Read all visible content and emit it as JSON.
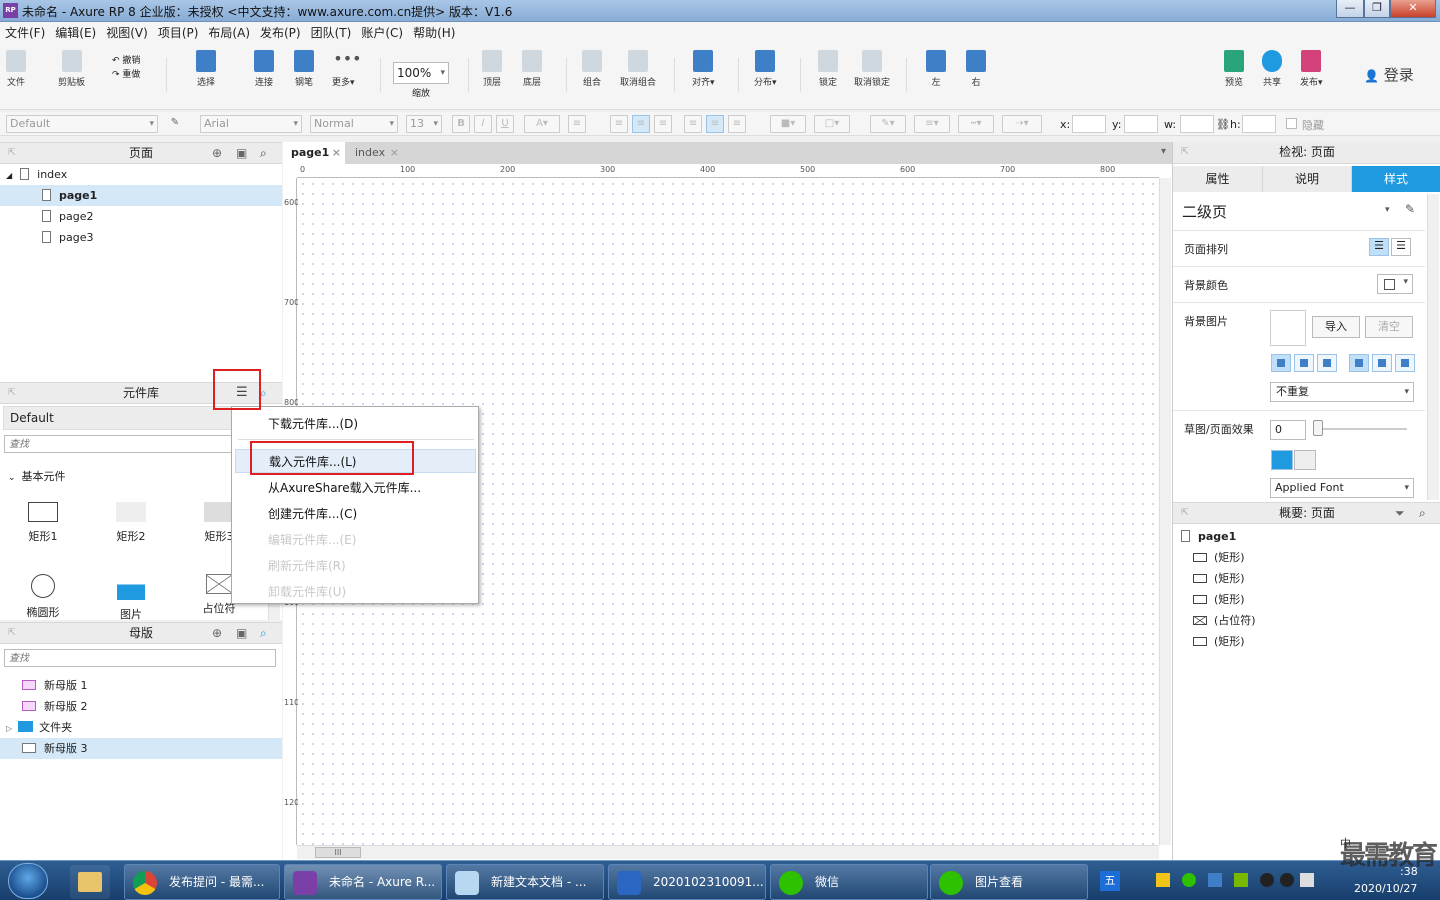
{
  "window": {
    "title": "未命名 - Axure RP 8 企业版：未授权      <中文支持：www.axure.com.cn提供> 版本：V1.6",
    "logo": "RP",
    "minimize": "—",
    "maximize": "❐",
    "close": "✕"
  },
  "menu": [
    "文件(F)",
    "编辑(E)",
    "视图(V)",
    "项目(P)",
    "布局(A)",
    "发布(P)",
    "团队(T)",
    "账户(C)",
    "帮助(H)"
  ],
  "toolbar": {
    "file": "文件",
    "clipboard": "剪贴板",
    "undo": "撤销",
    "redo": "重做",
    "select": "选择",
    "connect": "连接",
    "pen": "钢笔",
    "more": "更多▾",
    "zoom_value": "100%",
    "zoom_label": "缩放",
    "top": "顶层",
    "bottom": "底层",
    "group": "组合",
    "ungroup": "取消组合",
    "align": "对齐▾",
    "distribute": "分布▾",
    "lock": "锁定",
    "unlock": "取消锁定",
    "left": "左",
    "right": "右",
    "preview": "预览",
    "share": "共享",
    "publish": "发布▾",
    "login": "登录"
  },
  "format": {
    "style": "Default",
    "font": "Arial",
    "weight": "Normal",
    "size": "13",
    "x_label": "x:",
    "y_label": "y:",
    "w_label": "w:",
    "h_label": "h:",
    "hide": "隐藏"
  },
  "pages": {
    "header": "页面",
    "items": [
      {
        "label": "index",
        "level": 0,
        "selected": false
      },
      {
        "label": "page1",
        "level": 1,
        "selected": true
      },
      {
        "label": "page2",
        "level": 1,
        "selected": false
      },
      {
        "label": "page3",
        "level": 1,
        "selected": false
      }
    ]
  },
  "library": {
    "header": "元件库",
    "selected": "Default",
    "search_placeholder": "查找",
    "category": "基本元件",
    "widgets": [
      "矩形1",
      "矩形2",
      "矩形3",
      "椭圆形",
      "图片",
      "占位符"
    ]
  },
  "context_menu": {
    "items": [
      {
        "label": "下载元件库...(D)",
        "enabled": true
      },
      {
        "label": "载入元件库...(L)",
        "enabled": true
      },
      {
        "label": "从AxureShare载入元件库...",
        "enabled": true
      },
      {
        "label": "创建元件库...(C)",
        "enabled": true
      },
      {
        "label": "编辑元件库...(E)",
        "enabled": false
      },
      {
        "label": "刷新元件库(R)",
        "enabled": false
      },
      {
        "label": "卸载元件库(U)",
        "enabled": false
      }
    ]
  },
  "masters": {
    "header": "母版",
    "search_placeholder": "查找",
    "items": [
      {
        "label": "新母版 1"
      },
      {
        "label": "新母版 2"
      },
      {
        "label": "文件夹"
      },
      {
        "label": "新母版 3"
      }
    ]
  },
  "canvas": {
    "tabs": [
      "page1",
      "index"
    ],
    "ruler_h": [
      "0",
      "100",
      "200",
      "300",
      "400",
      "500",
      "600",
      "700",
      "800"
    ],
    "ruler_v": [
      "600",
      "700",
      "800",
      "900",
      "1000",
      "1100",
      "1200"
    ],
    "hscroll": "III"
  },
  "inspector": {
    "header": "检视: 页面",
    "tabs": [
      "属性",
      "说明",
      "样式"
    ],
    "page_name": "二级页",
    "page_align": "页面排列",
    "bg_color": "背景颜色",
    "bg_image": "背景图片",
    "import": "导入",
    "clear": "清空",
    "repeat": "不重复",
    "sketch": "草图/页面效果",
    "sketch_value": "0",
    "font": "Applied Font"
  },
  "outline": {
    "header": "概要: 页面",
    "root": "page1",
    "items": [
      "(矩形)",
      "(矩形)",
      "(矩形)",
      "(占位符)",
      "(矩形)"
    ]
  },
  "taskbar": {
    "items": [
      "发布提问 - 最需...",
      "未命名 - Axure R...",
      "新建文本文档 - ...",
      "2020102310091...",
      "微信",
      "图片查看"
    ],
    "date": "2020/10/27",
    "time_partial": ":38",
    "watermark": "最需教育",
    "ime": "中"
  }
}
